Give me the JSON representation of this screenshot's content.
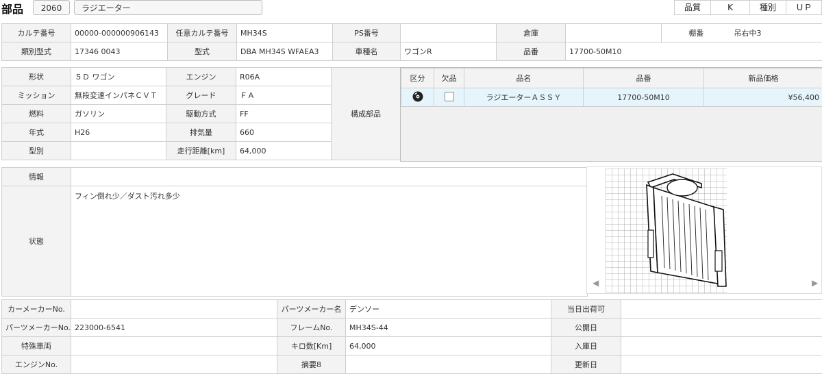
{
  "header": {
    "title": "部品",
    "code": "2060",
    "name": "ラジエーター",
    "quality_label": "品質",
    "quality_value": "K",
    "kind_label": "種別",
    "kind_value": "ＵＰ"
  },
  "info1": {
    "row1": [
      "カルテ番号",
      "00000-000000906143",
      "任意カルテ番号",
      "MH34S",
      "PS番号",
      "",
      "倉庫",
      "",
      "棚番",
      "吊右中3"
    ],
    "row2": [
      "類別型式",
      "17346 0043",
      "型式",
      "DBA MH34S WFAEA3",
      "車種名",
      "ワゴンR",
      "品番",
      "17700-50M10"
    ]
  },
  "info2": {
    "rows": [
      [
        "形状",
        "５Ｄ ワゴン",
        "エンジン",
        "R06A"
      ],
      [
        "ミッション",
        "無段変速インパネＣＶＴ",
        "グレード",
        "ＦＡ"
      ],
      [
        "燃料",
        "ガソリン",
        "駆動方式",
        "FF"
      ],
      [
        "年式",
        "H26",
        "排気量",
        "660"
      ],
      [
        "型別",
        "",
        "走行距離[km]",
        "64,000"
      ]
    ],
    "component_label": "構成部品"
  },
  "parts": {
    "headers": [
      "区分",
      "欠品",
      "品名",
      "品番",
      "新品価格"
    ],
    "rows": [
      {
        "icon": "disc-icon",
        "name": "ラジエーターＡＳＳＹ",
        "number": "17700-50M10",
        "price": "¥56,400"
      }
    ]
  },
  "notes": {
    "info_label": "情報",
    "info_value": "",
    "state_label": "状態",
    "state_value": "フィン倒れ少／ダスト汚れ多少"
  },
  "image_nav": {
    "prev": "◀",
    "next": "▶"
  },
  "bottom": {
    "r1": [
      "カーメーカーNo.",
      "",
      "パーツメーカー名",
      "デンソー",
      "当日出荷可",
      ""
    ],
    "r2": [
      "パーツメーカーNo.",
      "223000-6541",
      "フレームNo.",
      "MH34S-44",
      "公開日",
      ""
    ],
    "r3": [
      "特殊車両",
      "",
      "キロ数[Km]",
      "64,000",
      "入庫日",
      ""
    ],
    "r4": [
      "エンジンNo.",
      "",
      "摘要8",
      "",
      "更新日",
      ""
    ]
  }
}
